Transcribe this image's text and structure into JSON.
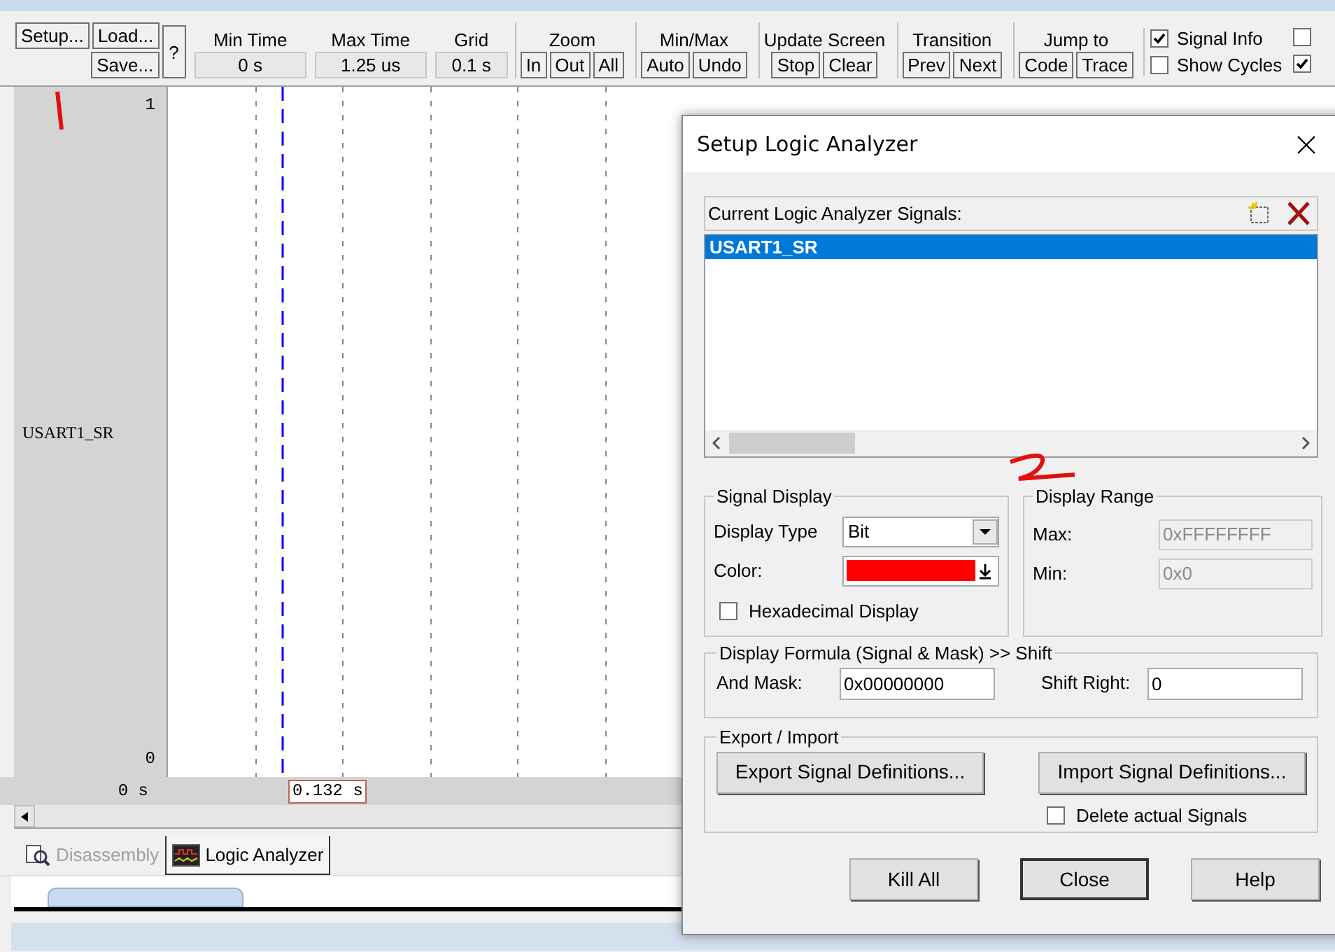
{
  "toolbar": {
    "setup_button": "Setup...",
    "load_button": "Load...",
    "save_button": "Save...",
    "help_button": "?",
    "readouts": [
      {
        "label": "Min Time",
        "value": "0 s"
      },
      {
        "label": "Max Time",
        "value": "1.25 us"
      },
      {
        "label": "Grid",
        "value": "0.1 s"
      }
    ],
    "groups": [
      {
        "label": "Zoom",
        "buttons": [
          "In",
          "Out",
          "All"
        ]
      },
      {
        "label": "Min/Max",
        "buttons": [
          "Auto",
          "Undo"
        ]
      },
      {
        "label": "Update Screen",
        "buttons": [
          "Stop",
          "Clear"
        ]
      },
      {
        "label": "Transition",
        "buttons": [
          "Prev",
          "Next"
        ]
      },
      {
        "label": "Jump to",
        "buttons": [
          "Code",
          "Trace"
        ]
      }
    ],
    "options": [
      {
        "label": "Signal Info",
        "checked": true
      },
      {
        "label": "Show Cycles",
        "checked": false
      }
    ],
    "cut_options": [
      {
        "checked": false
      },
      {
        "checked": true
      }
    ]
  },
  "plot": {
    "signal_name": "USART1_SR",
    "y_max": "1",
    "y_min": "0",
    "start_time": "0 s",
    "cursor_time": "0.132 s"
  },
  "bottom_tabs": [
    {
      "label": "Disassembly",
      "selected": false
    },
    {
      "label": "Logic Analyzer",
      "selected": true
    }
  ],
  "dialog": {
    "title": "Setup Logic Analyzer",
    "signals_label": "Current Logic Analyzer Signals:",
    "signals": [
      {
        "name": "USART1_SR",
        "selected": true
      }
    ],
    "signal_display": {
      "legend": "Signal Display",
      "type_label": "Display Type",
      "type_value": "Bit",
      "color_label": "Color:",
      "color": "#ff0000",
      "hex_label": "Hexadecimal Display",
      "hex_checked": false
    },
    "display_range": {
      "legend": "Display Range",
      "max_label": "Max:",
      "max_value": "0xFFFFFFFF",
      "min_label": "Min:",
      "min_value": "0x0",
      "disabled": true
    },
    "formula": {
      "legend": "Display Formula (Signal & Mask) >> Shift",
      "mask_label": "And Mask:",
      "mask_value": "0x00000000",
      "shift_label": "Shift Right:",
      "shift_value": "0"
    },
    "export_import": {
      "legend": "Export / Import",
      "export_button": "Export Signal Definitions...",
      "import_button": "Import Signal Definitions...",
      "delete_label": "Delete actual Signals",
      "delete_checked": false
    },
    "buttons": [
      "Kill All",
      "Close",
      "Help"
    ]
  }
}
